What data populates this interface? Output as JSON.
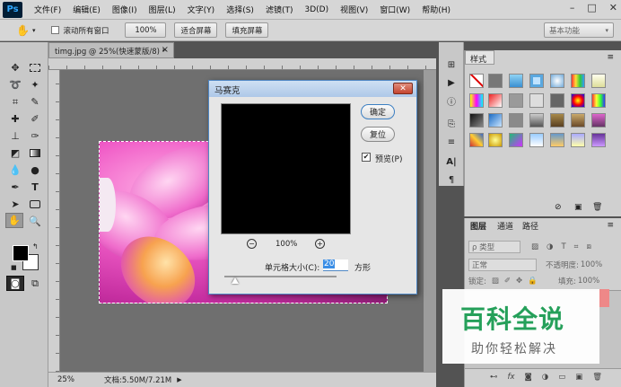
{
  "app": {
    "logo": "Ps"
  },
  "menu": [
    "文件(F)",
    "编辑(E)",
    "图像(I)",
    "图层(L)",
    "文字(Y)",
    "选择(S)",
    "滤镜(T)",
    "3D(D)",
    "视图(V)",
    "窗口(W)",
    "帮助(H)"
  ],
  "window_controls": {
    "minimize": "–",
    "maximize": "□",
    "close": "✕"
  },
  "options": {
    "scroll_all_label": "滚动所有窗口",
    "zoom_value": "100%",
    "fit_screen": "适合屏幕",
    "fill_screen": "填充屏幕",
    "workspace": "基本功能"
  },
  "document": {
    "tab_title": "timg.jpg @ 25%(快速蒙版/8) *",
    "tab_close": "×",
    "status_zoom": "25%",
    "status_doc": "文档:5.50M/7.21M"
  },
  "dialog": {
    "title": "马赛克",
    "close": "✕",
    "ok": "确定",
    "reset": "复位",
    "preview_label": "预览(P)",
    "preview_checked": true,
    "zoom": "100%",
    "cell_size_label": "单元格大小(C):",
    "cell_size_value": "20",
    "unit": "方形"
  },
  "styles_panel": {
    "tab": "样式"
  },
  "layers_panel": {
    "tabs": [
      "图层",
      "通道",
      "路径"
    ],
    "kind_filter": "ρ 类型",
    "blend_mode": "正常",
    "opacity_label": "不透明度:",
    "opacity_value": "100%",
    "lock_label": "锁定:",
    "fill_label": "填充:",
    "fill_value": "100%"
  },
  "watermark": {
    "title": "百科全说",
    "subtitle": "助你轻松解决"
  },
  "colors": {
    "accent": "#31a8ff",
    "dialog_border": "#4f87c4",
    "close_red": "#c5442f",
    "watermark_green": "#25a05a"
  }
}
